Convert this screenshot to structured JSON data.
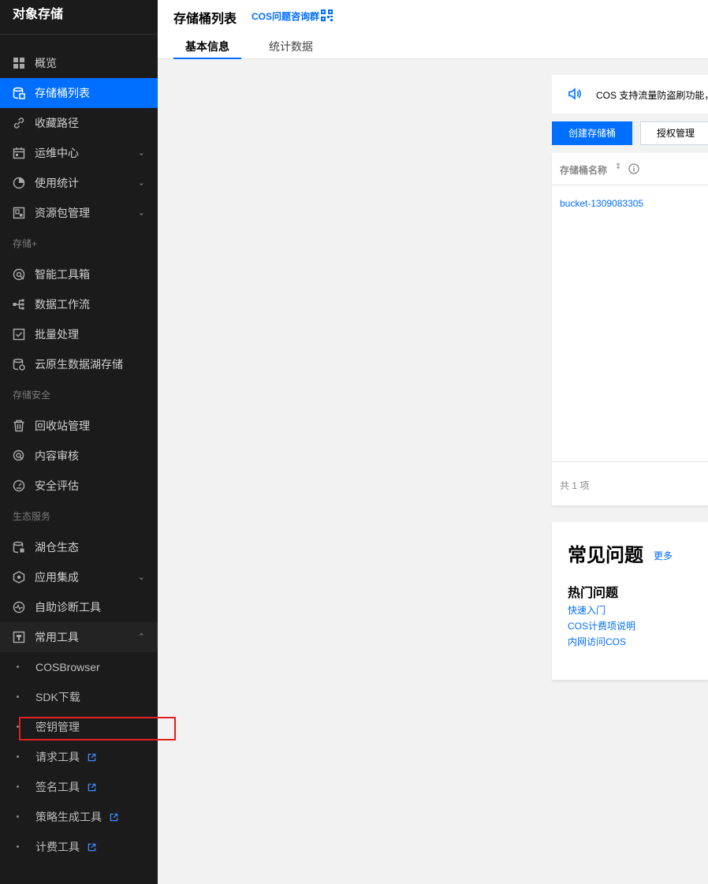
{
  "sidebar": {
    "title": "对象存储",
    "items": [
      {
        "label": "概览",
        "icon": "grid-icon"
      },
      {
        "label": "存储桶列表",
        "icon": "bucket-icon",
        "active": true
      },
      {
        "label": "收藏路径",
        "icon": "link-icon"
      },
      {
        "label": "运维中心",
        "icon": "calendar-icon",
        "chevron": "down"
      },
      {
        "label": "使用统计",
        "icon": "pie-icon",
        "chevron": "down"
      },
      {
        "label": "资源包管理",
        "icon": "package-icon",
        "chevron": "down"
      }
    ],
    "group_storage_plus": "存储+",
    "storage_plus_items": [
      {
        "label": "智能工具箱",
        "icon": "toolbox-icon"
      },
      {
        "label": "数据工作流",
        "icon": "workflow-icon"
      },
      {
        "label": "批量处理",
        "icon": "checkbox-icon"
      },
      {
        "label": "云原生数据湖存储",
        "icon": "database-icon"
      }
    ],
    "group_security": "存储安全",
    "security_items": [
      {
        "label": "回收站管理",
        "icon": "trash-icon"
      },
      {
        "label": "内容审核",
        "icon": "audit-icon"
      },
      {
        "label": "安全评估",
        "icon": "gauge-icon"
      }
    ],
    "group_eco": "生态服务",
    "eco_items": [
      {
        "label": "湖仓生态",
        "icon": "lakehouse-icon"
      },
      {
        "label": "应用集成",
        "icon": "integration-icon",
        "chevron": "down"
      },
      {
        "label": "自助诊断工具",
        "icon": "diagnose-icon"
      },
      {
        "label": "常用工具",
        "icon": "tool-icon",
        "chevron": "up",
        "open": true
      }
    ],
    "sub_items": [
      {
        "label": "COSBrowser"
      },
      {
        "label": "SDK下载"
      },
      {
        "label": "密钥管理"
      },
      {
        "label": "请求工具",
        "external": true
      },
      {
        "label": "签名工具",
        "external": true
      },
      {
        "label": "策略生成工具",
        "external": true
      },
      {
        "label": "计费工具",
        "external": true
      }
    ]
  },
  "header": {
    "title": "存储桶列表",
    "cos_link": "COS问题咨询群",
    "tabs": [
      {
        "label": "基本信息",
        "active": true
      },
      {
        "label": "统计数据"
      }
    ]
  },
  "notice": {
    "text": "COS 支持流量防盗刷功能，"
  },
  "toolbar": {
    "create_label": "创建存储桶",
    "auth_label": "授权管理"
  },
  "table": {
    "col_name": "存储桶名称",
    "rows": [
      {
        "name": "bucket-1309083305"
      }
    ],
    "total": "共 1 项"
  },
  "faq": {
    "title": "常见问题",
    "more": "更多",
    "hot_title": "热门问题",
    "links": [
      "快速入门",
      "COS计费项说明",
      "内网访问COS"
    ]
  },
  "colors": {
    "accent": "#006eff",
    "sidebar_bg": "#1b1b1b",
    "highlight": "#e02020"
  }
}
